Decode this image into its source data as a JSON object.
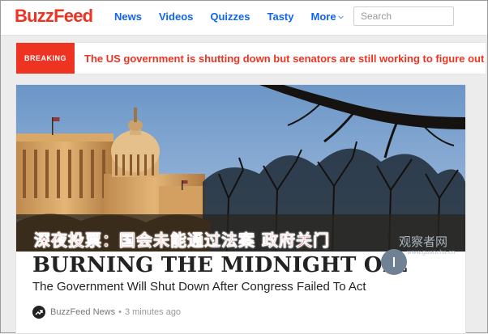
{
  "header": {
    "logo": "BuzzFeed",
    "nav": [
      "News",
      "Videos",
      "Quizzes",
      "Tasty"
    ],
    "more_label": "More",
    "search_placeholder": "Search"
  },
  "breaking": {
    "badge": "BREAKING",
    "text": "The US government is shutting down but senators are still working to figure out a deal"
  },
  "article": {
    "overlay_caption": "深夜投票：国会未能通过法案 政府关门",
    "watermark": "观察者网",
    "watermark_url": "www.guancha.cn",
    "headline": "BURNING THE MIDNIGHT OIL",
    "subheadline": "The Government Will Shut Down After Congress Failed To Act",
    "byline_source": "BuzzFeed News",
    "byline_separator": "•",
    "byline_time": "3 minutes ago"
  },
  "colors": {
    "brand_red": "#ee3322",
    "nav_blue": "#0f65ef",
    "overlay_red": "#ee1c1c"
  }
}
